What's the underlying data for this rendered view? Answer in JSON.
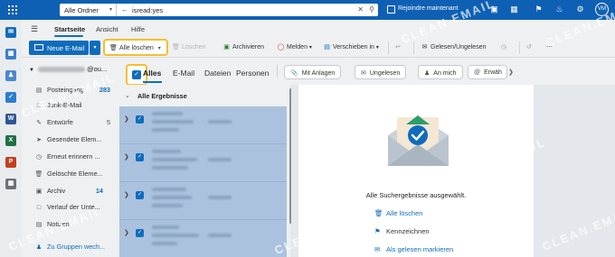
{
  "topbar": {
    "folder_select": "Alle Ordner",
    "search_query": "isread:yes",
    "meet_now": "Rejoindre maintenant",
    "avatar_initials": "VM"
  },
  "ribbon": {
    "tabs": [
      "Startseite",
      "Ansicht",
      "Hilfe"
    ],
    "new_mail": "Neue E-Mail",
    "delete_all": "Alle löschen",
    "delete_disabled": "Löschen",
    "archive": "Archivieren",
    "report": "Melden",
    "move": "Verschieben in",
    "read_unread": "Gelesen/Ungelesen"
  },
  "folders": {
    "account": "@ou...",
    "items": [
      {
        "label": "Posteingang",
        "count": "283",
        "icon": "inbox-icon"
      },
      {
        "label": "Junk-E-Mail",
        "count": "",
        "icon": "junk-icon"
      },
      {
        "label": "Entwürfe",
        "count": "5",
        "icon": "draft-icon"
      },
      {
        "label": "Gesendete Elem...",
        "count": "",
        "icon": "sent-icon"
      },
      {
        "label": "Erneut erinnern ...",
        "count": "",
        "icon": "clock-icon"
      },
      {
        "label": "Gelöschte Eleme...",
        "count": "",
        "icon": "trash-icon"
      },
      {
        "label": "Archiv",
        "count": "14",
        "icon": "archive-icon"
      },
      {
        "label": "Verlauf der Unte...",
        "count": "",
        "icon": "folder-icon"
      },
      {
        "label": "Notizen",
        "count": "",
        "icon": "notes-icon"
      }
    ],
    "add_groups": "Zu Gruppen wech..."
  },
  "filterbar": {
    "tabs": [
      "Alles",
      "E-Mail",
      "Dateien",
      "Personen"
    ],
    "chips": [
      "Mit Anlagen",
      "Ungelesen",
      "An mich",
      "Erwäh"
    ]
  },
  "list": {
    "group": "Alle Ergebnisse"
  },
  "reading": {
    "title": "Alle Suchergebnisse ausgewählt.",
    "actions": [
      "Alle löschen",
      "Kennzeichnen",
      "Als gelesen markieren"
    ]
  },
  "watermark": "CLEAN.EMAIL",
  "colors": {
    "accent": "#0f6cbd",
    "highlight": "#f3c12c",
    "topbar": "#0e60b4"
  }
}
